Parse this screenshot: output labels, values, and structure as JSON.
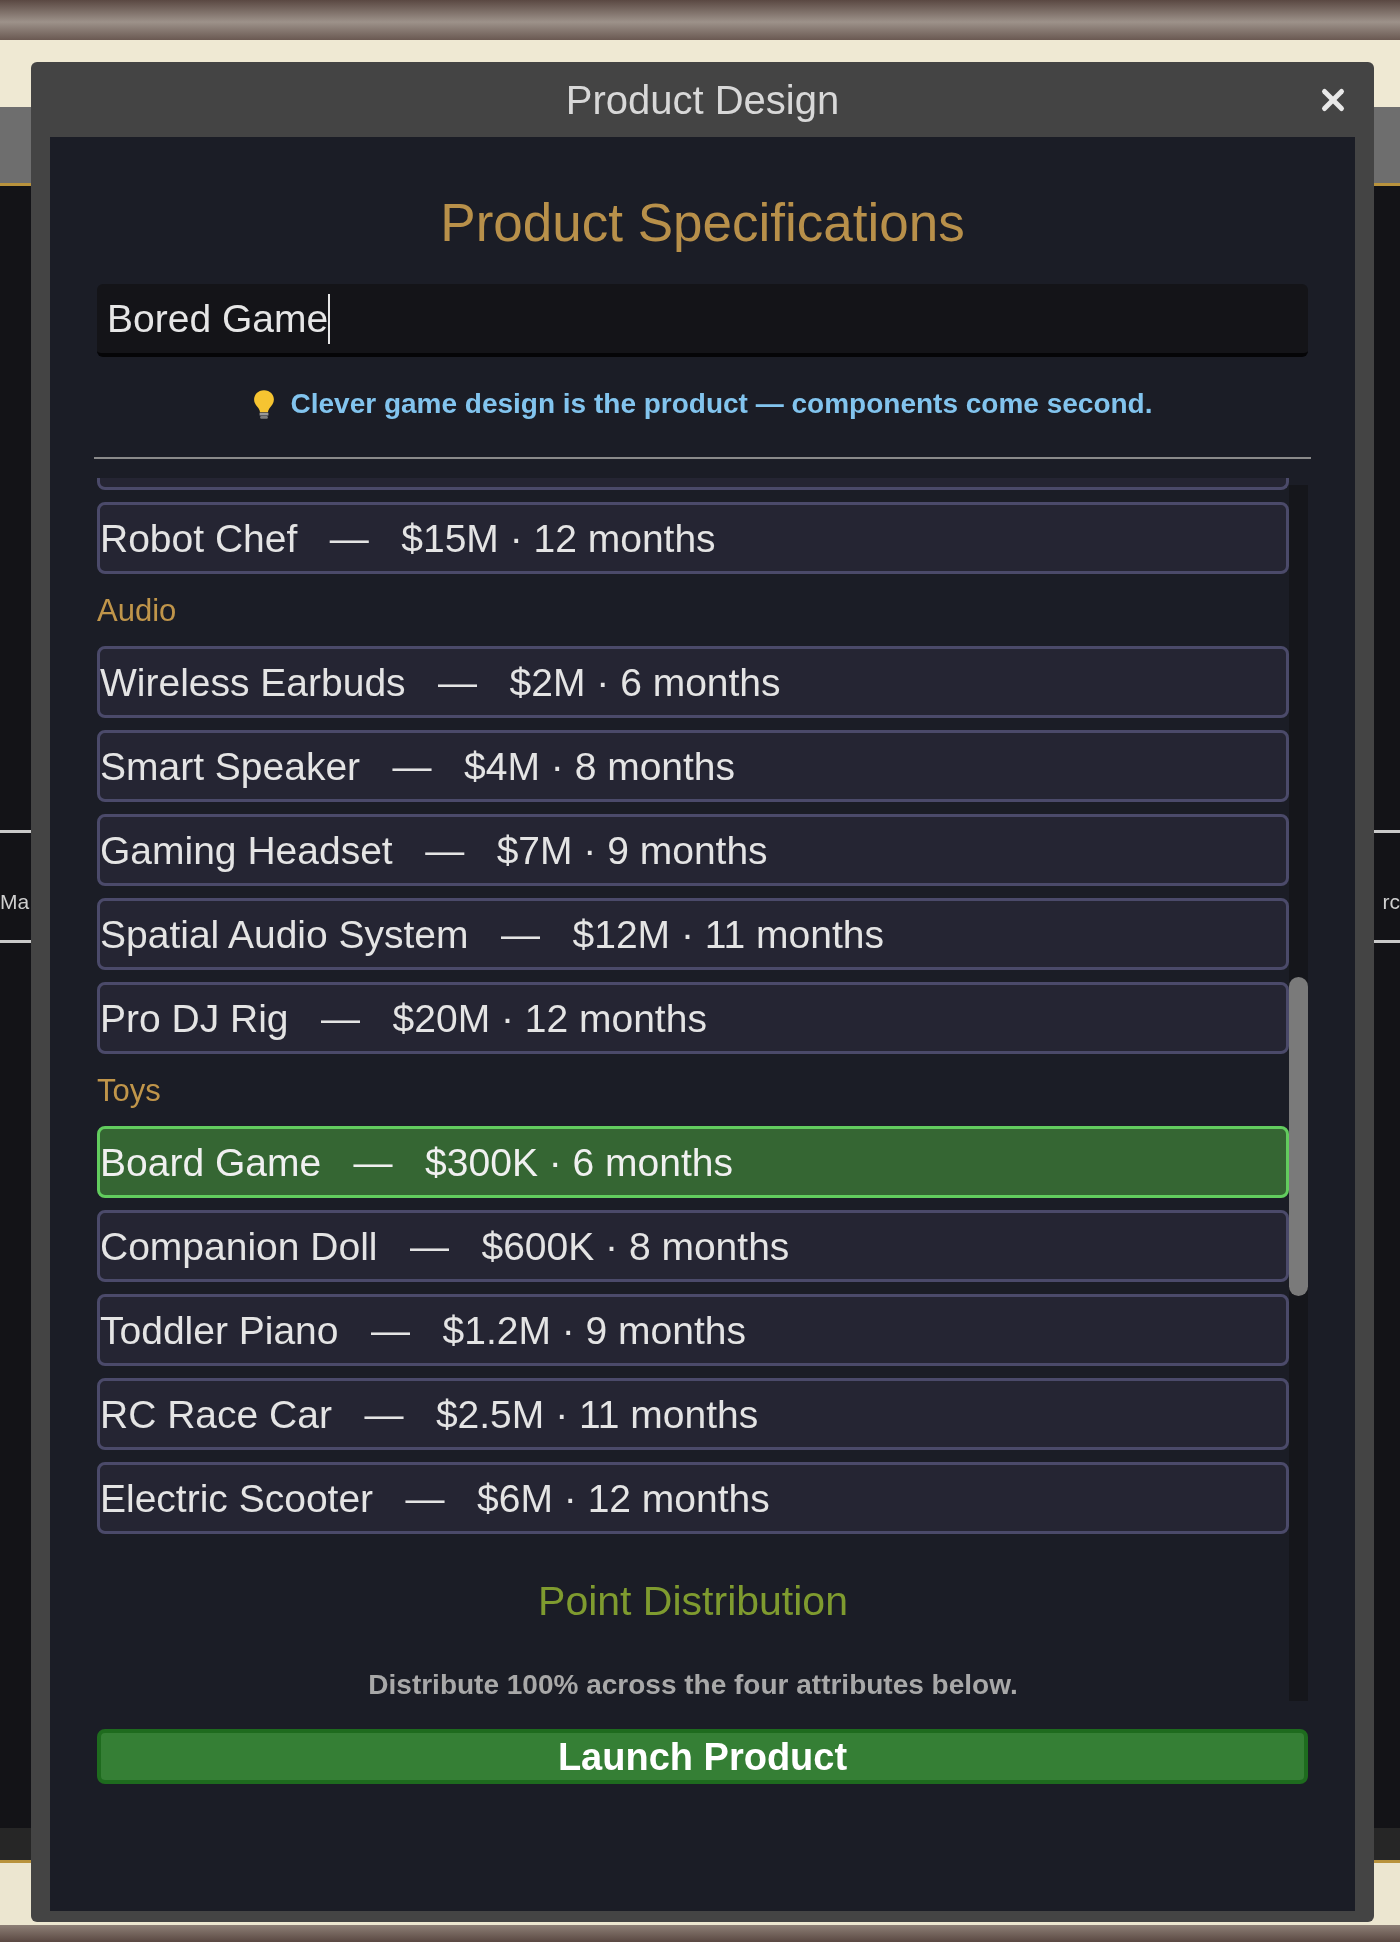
{
  "backdrop": {
    "left_label": "Ma",
    "right_label": "rc"
  },
  "dialog": {
    "title": "Product Design"
  },
  "form": {
    "heading": "Product Specifications",
    "name_field": {
      "value": "Bored Game"
    },
    "hint": "Clever game design is the product — components come second."
  },
  "catalog": [
    {
      "kind": "item",
      "label": "Robot Chef   —   $15M · 12 months",
      "selected": false
    },
    {
      "kind": "category",
      "label": "Audio"
    },
    {
      "kind": "item",
      "label": "Wireless Earbuds   —   $2M · 6 months",
      "selected": false
    },
    {
      "kind": "item",
      "label": "Smart Speaker   —   $4M · 8 months",
      "selected": false
    },
    {
      "kind": "item",
      "label": "Gaming Headset   —   $7M · 9 months",
      "selected": false
    },
    {
      "kind": "item",
      "label": "Spatial Audio System   —   $12M · 11 months",
      "selected": false
    },
    {
      "kind": "item",
      "label": "Pro DJ Rig   —   $20M · 12 months",
      "selected": false
    },
    {
      "kind": "category",
      "label": "Toys"
    },
    {
      "kind": "item",
      "label": "Board Game   —   $300K · 6 months",
      "selected": true
    },
    {
      "kind": "item",
      "label": "Companion Doll   —   $600K · 8 months",
      "selected": false
    },
    {
      "kind": "item",
      "label": "Toddler Piano   —   $1.2M · 9 months",
      "selected": false
    },
    {
      "kind": "item",
      "label": "RC Race Car   —   $2.5M · 11 months",
      "selected": false
    },
    {
      "kind": "item",
      "label": "Electric Scooter   —   $6M · 12 months",
      "selected": false
    }
  ],
  "distribution": {
    "heading": "Point Distribution",
    "description": "Distribute 100% across the four attributes below."
  },
  "launch_button": "Launch Product"
}
